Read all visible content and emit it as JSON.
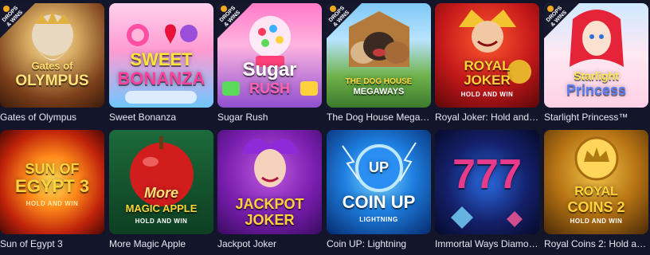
{
  "badge": {
    "line1": "DROPS",
    "line2": "& WINS"
  },
  "games": [
    {
      "name": "Gates of Olympus",
      "art_title": "Gates of",
      "art_title2": "OLYMPUS",
      "badge": true
    },
    {
      "name": "Sweet Bonanza",
      "art_title": "SWEET",
      "art_title2": "BONANZA",
      "badge": false
    },
    {
      "name": "Sugar Rush",
      "art_title": "Sugar",
      "art_title2": "RUSH",
      "badge": true
    },
    {
      "name": "The Dog House Megaw...",
      "art_title": "THE DOG HOUSE",
      "art_title2": "MEGAWAYS",
      "badge": true
    },
    {
      "name": "Royal Joker: Hold and W...",
      "art_title": "ROYAL",
      "art_title2": "JOKER",
      "art_sub": "HOLD AND WIN",
      "badge": false
    },
    {
      "name": "Starlight Princess™",
      "art_title": "Starlight",
      "art_title2": "Princess",
      "badge": true
    },
    {
      "name": "Sun of Egypt 3",
      "art_title": "SUN OF",
      "art_title2": "EGYPT 3",
      "art_sub": "HOLD AND WIN",
      "badge": false
    },
    {
      "name": "More Magic Apple",
      "art_title": "More",
      "art_title2": "MAGIC APPLE",
      "art_sub": "HOLD AND WIN",
      "badge": false
    },
    {
      "name": "Jackpot Joker",
      "art_title": "JACKPOT",
      "art_title2": "JOKER",
      "badge": false
    },
    {
      "name": "Coin UP: Lightning",
      "art_title": "COIN UP",
      "art_title2": "UP",
      "art_sub": "LIGHTNING",
      "badge": false
    },
    {
      "name": "Immortal Ways Diamonds",
      "art_title": "777",
      "badge": false
    },
    {
      "name": "Royal Coins 2: Hold and ...",
      "art_title": "ROYAL",
      "art_title2": "COINS 2",
      "art_sub": "HOLD AND WIN",
      "badge": false
    }
  ]
}
